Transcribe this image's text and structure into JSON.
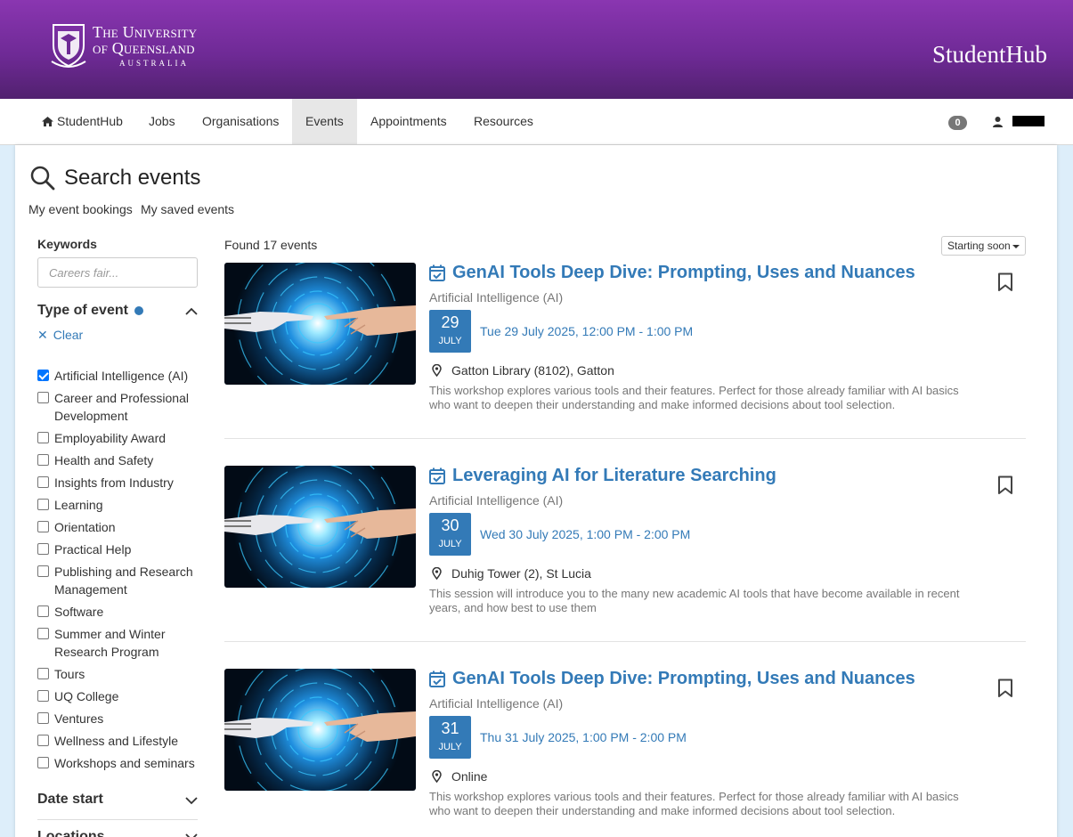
{
  "header": {
    "logo_line1": "The University",
    "logo_line2": "of Queensland",
    "logo_line3": "AUSTRALIA",
    "app_title": "StudentHub"
  },
  "nav": {
    "items": [
      {
        "label": "StudentHub",
        "icon": "home-icon"
      },
      {
        "label": "Jobs"
      },
      {
        "label": "Organisations"
      },
      {
        "label": "Events",
        "active": true
      },
      {
        "label": "Appointments"
      },
      {
        "label": "Resources"
      }
    ],
    "notification_count": "0"
  },
  "page": {
    "title": "Search events",
    "links": [
      "My event bookings",
      "My saved events"
    ]
  },
  "filters": {
    "keywords_label": "Keywords",
    "keywords_placeholder": "Careers fair...",
    "type_label": "Type of event",
    "clear_label": "Clear",
    "types": [
      {
        "label": "Artificial Intelligence (AI)",
        "checked": true
      },
      {
        "label": "Career and Professional Development",
        "checked": false
      },
      {
        "label": "Employability Award",
        "checked": false
      },
      {
        "label": "Health and Safety",
        "checked": false
      },
      {
        "label": "Insights from Industry",
        "checked": false
      },
      {
        "label": "Learning",
        "checked": false
      },
      {
        "label": "Orientation",
        "checked": false
      },
      {
        "label": "Practical Help",
        "checked": false
      },
      {
        "label": "Publishing and Research Management",
        "checked": false
      },
      {
        "label": "Software",
        "checked": false
      },
      {
        "label": "Summer and Winter Research Program",
        "checked": false
      },
      {
        "label": "Tours",
        "checked": false
      },
      {
        "label": "UQ College",
        "checked": false
      },
      {
        "label": "Ventures",
        "checked": false
      },
      {
        "label": "Wellness and Lifestyle",
        "checked": false
      },
      {
        "label": "Workshops and seminars",
        "checked": false
      }
    ],
    "date_start_label": "Date start",
    "locations_label": "Locations"
  },
  "results": {
    "found_text": "Found 17 events",
    "sort_label": "Starting soon",
    "events": [
      {
        "title": "GenAI Tools Deep Dive: Prompting, Uses and Nuances",
        "category": "Artificial Intelligence (AI)",
        "day": "29",
        "month": "JULY",
        "when": "Tue 29 July 2025, 12:00 PM - 1:00 PM",
        "where": "Gatton Library (8102), Gatton",
        "description": "This workshop explores various tools and their features. Perfect for those already familiar with AI basics who want to deepen their understanding and make informed decisions about tool selection."
      },
      {
        "title": "Leveraging AI for Literature Searching",
        "category": "Artificial Intelligence (AI)",
        "day": "30",
        "month": "JULY",
        "when": "Wed 30 July 2025, 1:00 PM - 2:00 PM",
        "where": "Duhig Tower (2), St Lucia",
        "description": "This session will introduce you to the many new academic AI tools that have become available in recent years, and how best to use them"
      },
      {
        "title": "GenAI Tools Deep Dive: Prompting, Uses and Nuances",
        "category": "Artificial Intelligence (AI)",
        "day": "31",
        "month": "JULY",
        "when": "Thu 31 July 2025, 1:00 PM - 2:00 PM",
        "where": "Online",
        "description": "This workshop explores various tools and their features. Perfect for those already familiar with AI basics who want to deepen their understanding and make informed decisions about tool selection."
      }
    ]
  },
  "colors": {
    "brand_purple": "#7a2fa3",
    "link_blue": "#337ab7",
    "page_bg": "#ddeefa"
  }
}
